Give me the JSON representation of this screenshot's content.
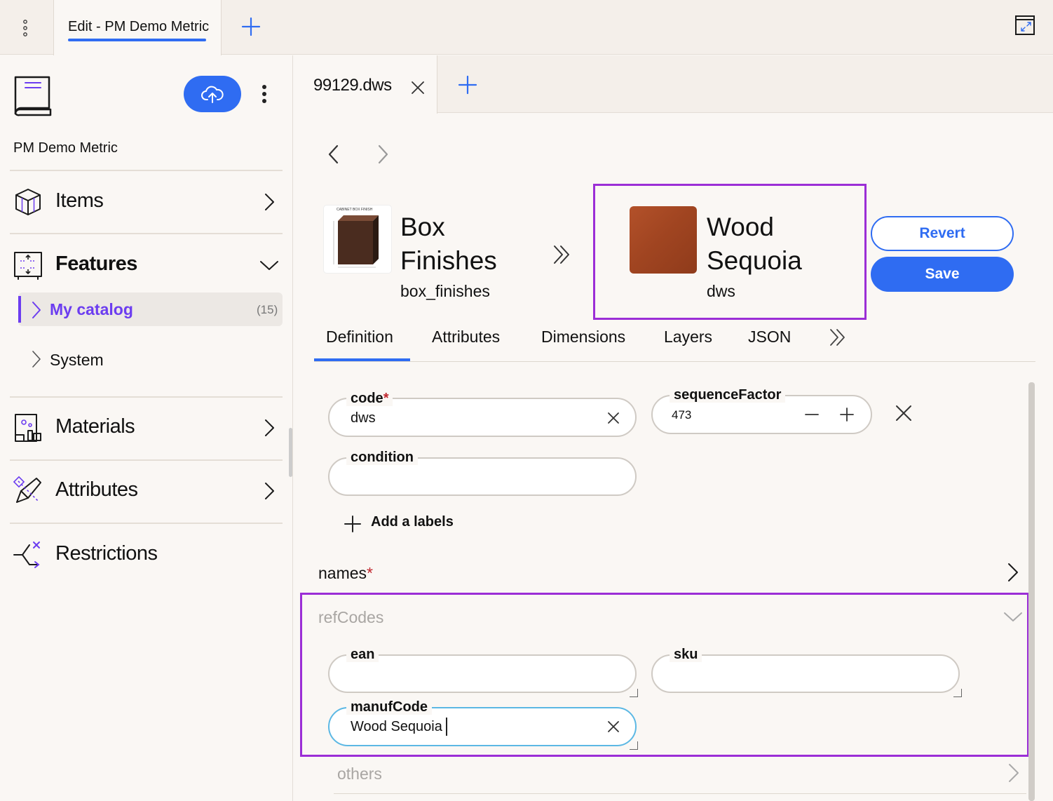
{
  "top_tabs": {
    "active_label": "Edit - PM Demo Metric"
  },
  "sidebar": {
    "catalog_name": "PM Demo Metric",
    "nav": [
      {
        "label": "Items",
        "icon": "cube-icon",
        "state": "collapsed"
      },
      {
        "label": "Features",
        "icon": "features-icon",
        "state": "expanded"
      },
      {
        "label": "Materials",
        "icon": "materials-icon",
        "state": "collapsed"
      },
      {
        "label": "Attributes",
        "icon": "attributes-icon",
        "state": "collapsed"
      },
      {
        "label": "Restrictions",
        "icon": "restrictions-icon",
        "state": "none"
      }
    ],
    "features_children": [
      {
        "label": "My catalog",
        "count": "(15)",
        "selected": true
      },
      {
        "label": "System"
      }
    ]
  },
  "file_tabs": {
    "active_label": "99129.dws"
  },
  "feature": {
    "from": {
      "title": "Box Finishes",
      "code": "box_finishes"
    },
    "to": {
      "title": "Wood Sequoia",
      "code": "dws",
      "swatch_color": "#a14521"
    },
    "actions": {
      "revert": "Revert",
      "save": "Save"
    }
  },
  "detail_tabs": [
    "Definition",
    "Attributes",
    "Dimensions",
    "Layers",
    "JSON"
  ],
  "definition": {
    "code": {
      "label": "code",
      "required": "*",
      "value": "dws"
    },
    "sequence_factor": {
      "label": "sequenceFactor",
      "value": "473"
    },
    "condition": {
      "label": "condition",
      "value": ""
    },
    "add_labels": "Add a labels",
    "names": {
      "label": "names",
      "required": "*"
    },
    "ref_codes": {
      "label": "refCodes",
      "ean": {
        "label": "ean",
        "value": ""
      },
      "sku": {
        "label": "sku",
        "value": ""
      },
      "manuf_code": {
        "label": "manufCode",
        "value": "Wood Sequoia"
      }
    },
    "others": {
      "label": "others"
    }
  },
  "colors": {
    "accent": "#2f6cf2",
    "highlight": "#9b2ed6",
    "selected_nav": "#6c3df0",
    "required": "#c0262d"
  }
}
